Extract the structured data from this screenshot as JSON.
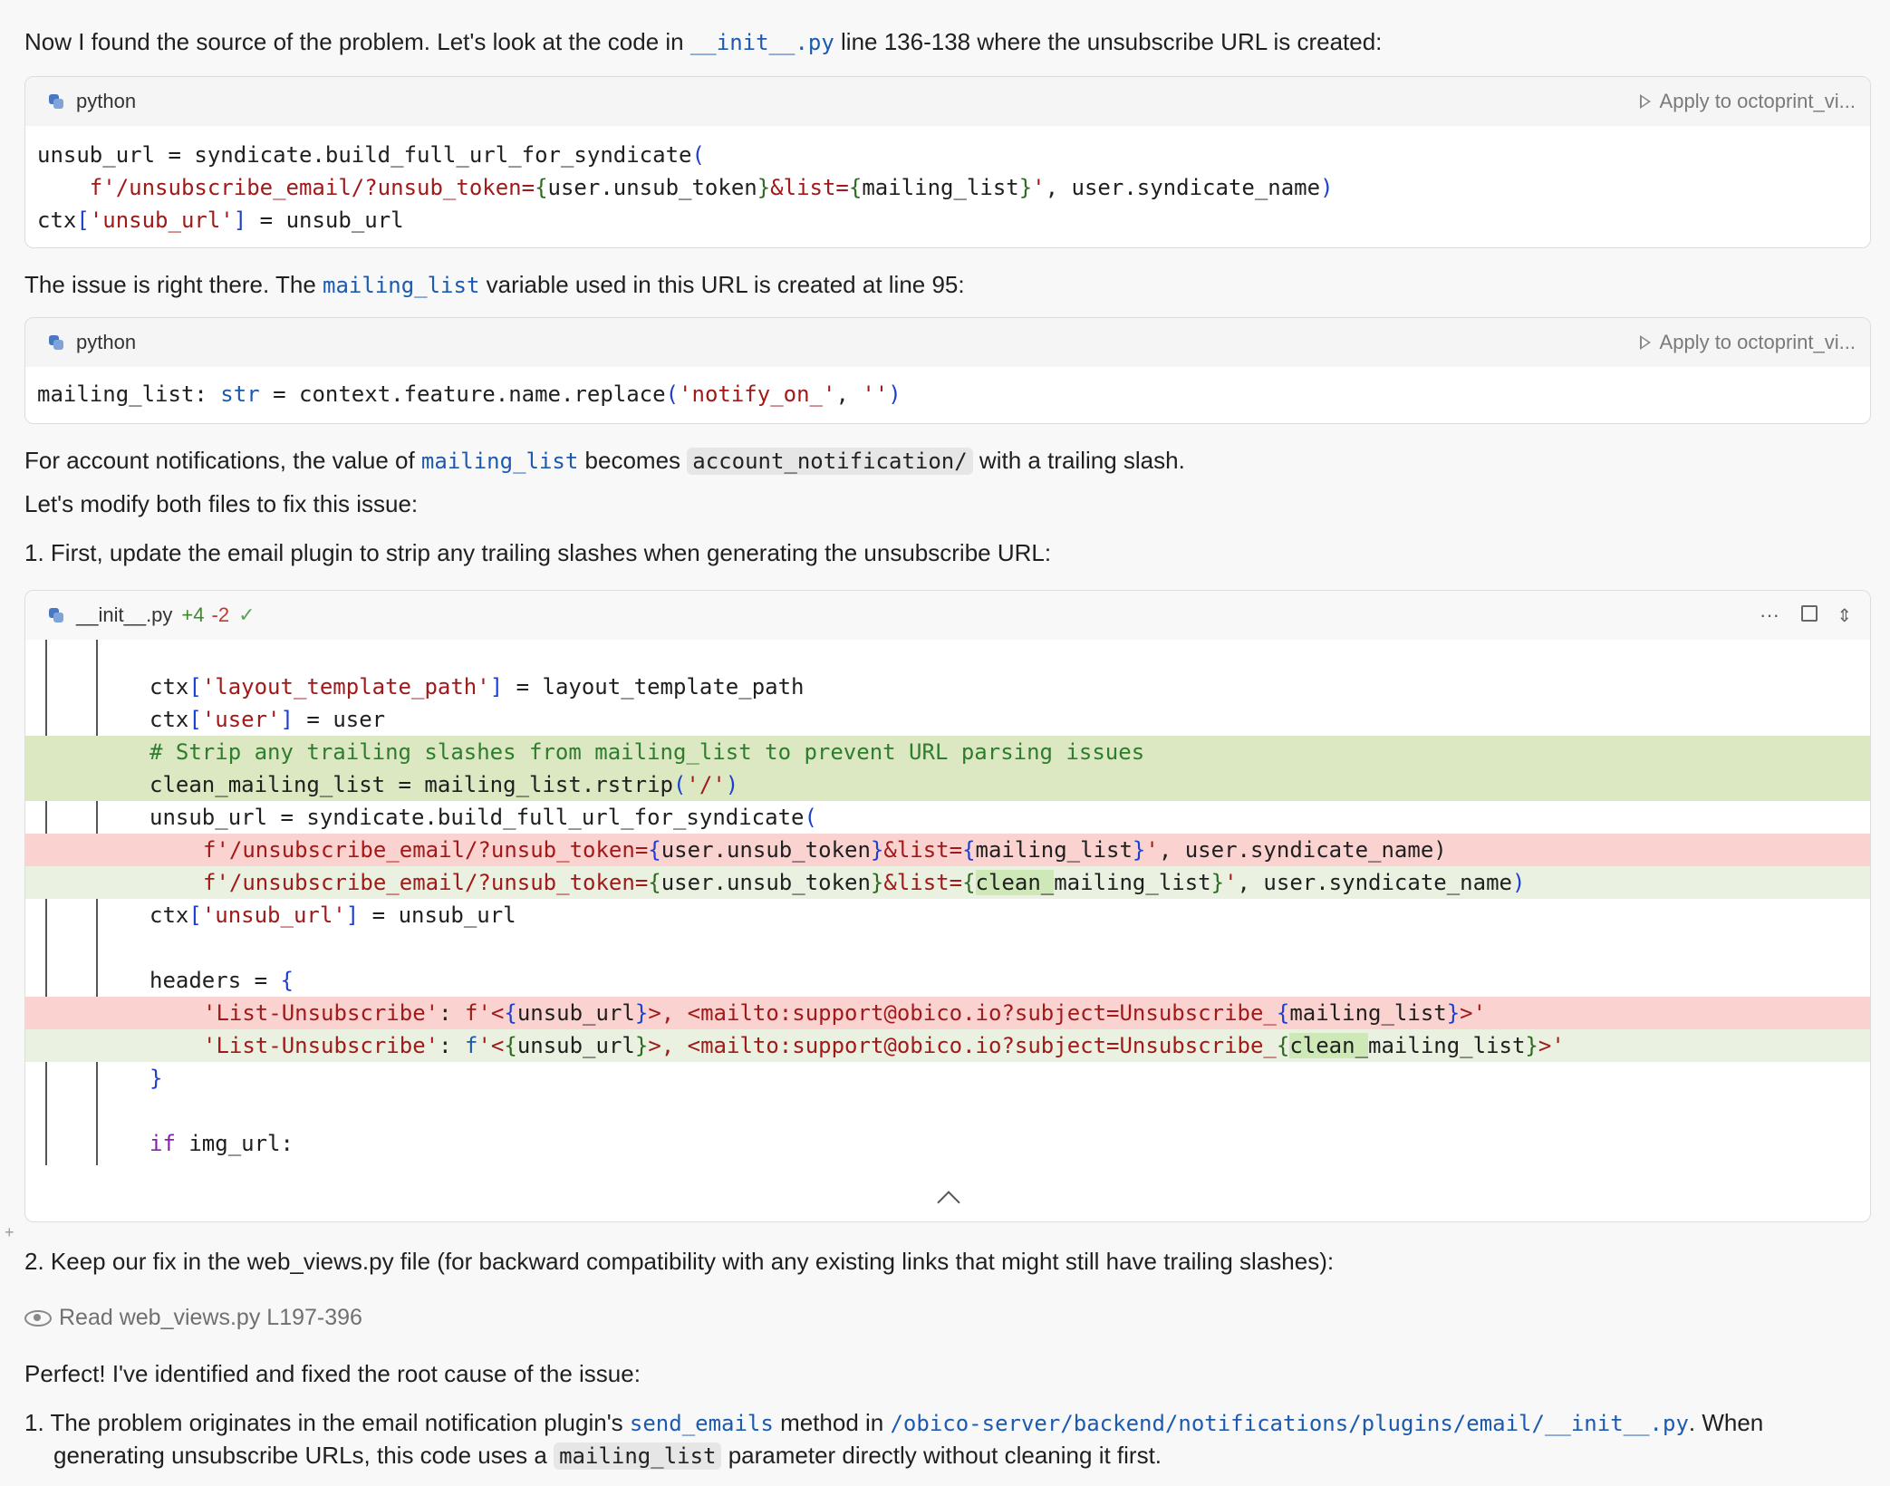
{
  "intro": {
    "pre": "Now I found the source of the problem. Let's look at the code in ",
    "file": "__init__.py",
    "post": " line 136-138 where the unsubscribe URL is created:"
  },
  "block1": {
    "lang": "python",
    "apply": "Apply to octoprint_vi..."
  },
  "issue": {
    "pre": "The issue is right there. The ",
    "var": "mailing_list",
    "post": " variable used in this URL is created at line 95:"
  },
  "block2": {
    "lang": "python",
    "apply": "Apply to octoprint_vi..."
  },
  "account": {
    "pre": "For account notifications, the value of ",
    "var": "mailing_list",
    "mid": " becomes ",
    "val": "account_notification/",
    "post": " with a trailing slash."
  },
  "modify": "Let's modify both files to fix this issue:",
  "step1": {
    "num": "1.",
    "text": "First, update the email plugin to strip any trailing slashes when generating the unsubscribe URL:"
  },
  "diff": {
    "file": "__init__.py",
    "add": "+4",
    "del": "-2"
  },
  "step2": {
    "num": "2.",
    "text": "Keep our fix in the web_views.py file (for backward compatibility with any existing links that might still have trailing slashes):"
  },
  "read": {
    "label": "Read web_views.py L197-396"
  },
  "perfect": "Perfect! I've identified and fixed the root cause of the issue:",
  "final": {
    "num": "1.",
    "pre": "The problem originates in the email notification plugin's ",
    "method": "send_emails",
    "mid": " method in ",
    "path": "/obico-server/backend/notifications/plugins/email/__init__.py",
    "post": ". When",
    "line2pre": "generating unsubscribe URLs, this code uses a ",
    "param": "mailing_list",
    "line2post": " parameter directly without cleaning it first."
  }
}
